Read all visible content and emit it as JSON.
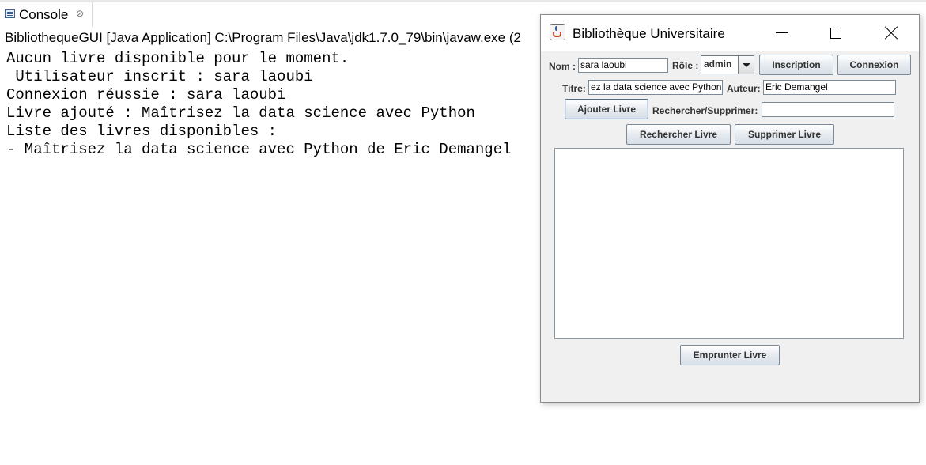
{
  "console": {
    "tab_label": "Console",
    "tab_close_symbol": "⊘",
    "process_line": "BibliothequeGUI [Java Application] C:\\Program Files\\Java\\jdk1.7.0_79\\bin\\javaw.exe (2",
    "output_lines": [
      "Aucun livre disponible pour le moment.",
      " Utilisateur inscrit : sara laoubi",
      "Connexion réussie : sara laoubi",
      "Livre ajouté : Maîtrisez la data science avec Python",
      "Liste des livres disponibles :",
      "- Maîtrisez la data science avec Python de Eric Demangel"
    ]
  },
  "window": {
    "title": "Bibliothèque Universitaire",
    "icon": "java-icon"
  },
  "form": {
    "nom_label": "Nom :",
    "nom_value": "sara laoubi",
    "role_label": "Rôle :",
    "role_value": "admin",
    "inscription_label": "Inscription",
    "connexion_label": "Connexion",
    "titre_label": "Titre:",
    "titre_value": "ez la data science avec Python",
    "auteur_label": "Auteur:",
    "auteur_value": "Eric Demangel",
    "ajouter_label": "Ajouter Livre",
    "rechercher_supprimer_label": "Rechercher/Supprimer:",
    "rechercher_supprimer_value": "",
    "rechercher_label": "Rechercher Livre",
    "supprimer_label": "Supprimer Livre",
    "emprunter_label": "Emprunter Livre"
  }
}
